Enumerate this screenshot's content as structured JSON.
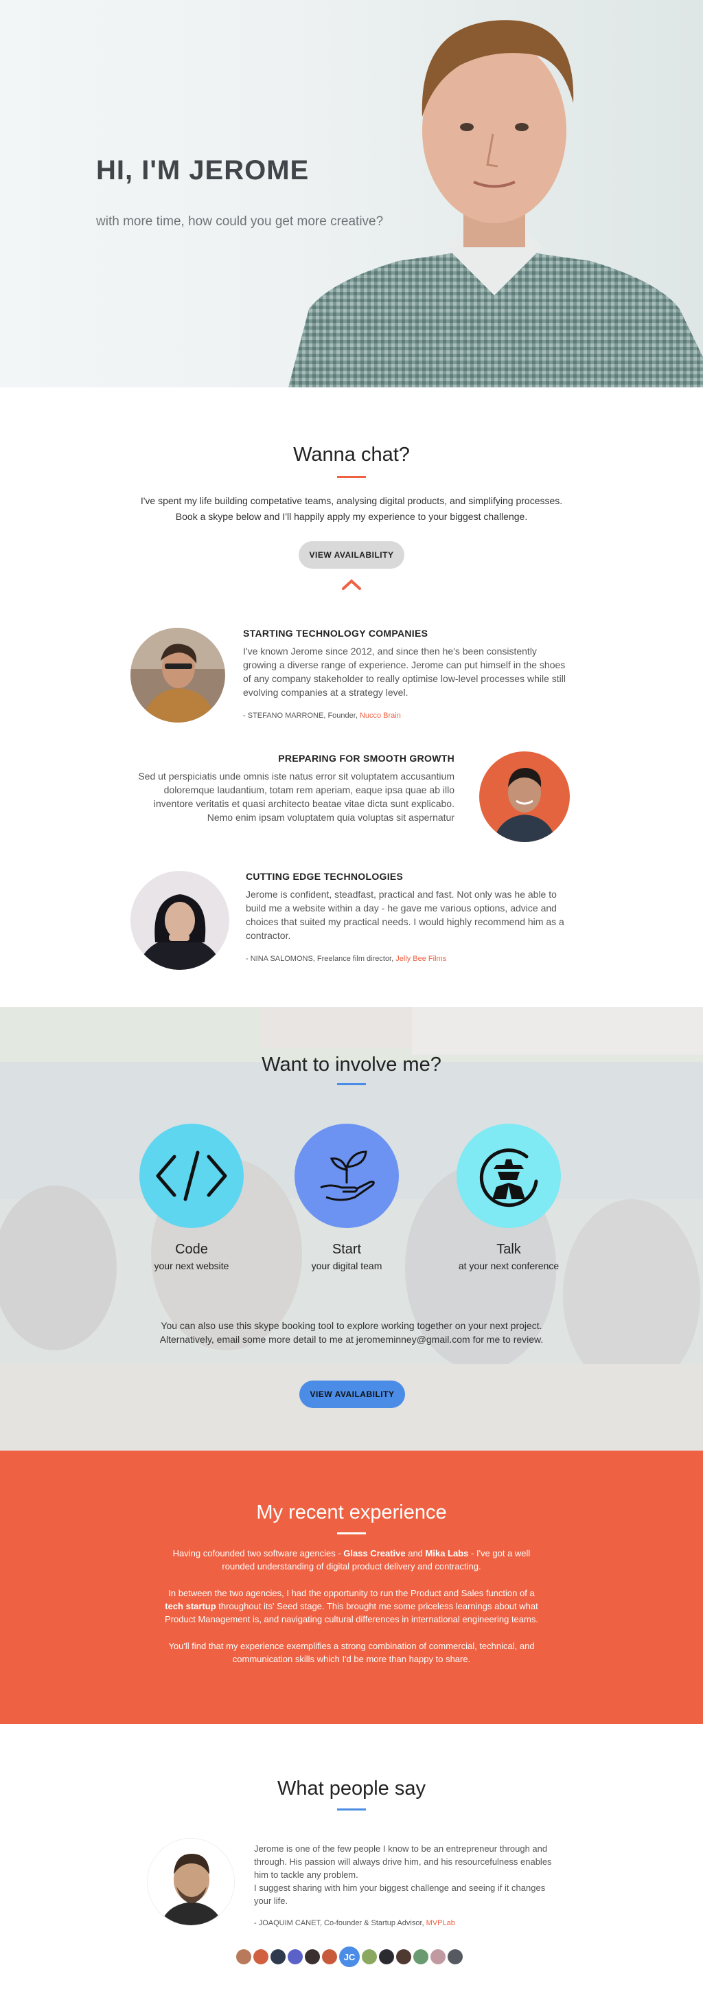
{
  "hero": {
    "title": "HI, I'M JEROME",
    "subtitle": "with more time, how could you get more creative?"
  },
  "chat": {
    "title": "Wanna chat?",
    "text": "I've spent my life building competative teams, analysing digital products, and simplifying processes. Book a skype below and I'll happily apply my experience to your biggest challenge.",
    "button": "VIEW AVAILABILITY",
    "chevron_icon": "chevron-up-icon"
  },
  "testimonials": [
    {
      "heading": "STARTING TECHNOLOGY COMPANIES",
      "body": "I've known Jerome since 2012, and since then he's been consistently growing a diverse range of experience. Jerome can put himself in the shoes of any company stakeholder to really optimise low-level processes while still evolving companies at a strategy level.",
      "cite_prefix": "- STEFANO MARRONE, Founder, ",
      "cite_link": "Nucco Brain"
    },
    {
      "heading": "PREPARING FOR SMOOTH GROWTH",
      "body": "Sed ut perspiciatis unde omnis iste natus error sit voluptatem accusantium doloremque laudantium, totam rem aperiam, eaque ipsa quae ab illo inventore veritatis et quasi architecto beatae vitae dicta sunt explicabo. Nemo enim ipsam voluptatem quia voluptas sit aspernatur"
    },
    {
      "heading": "CUTTING EDGE TECHNOLOGIES",
      "body": "Jerome is confident, steadfast, practical and fast. Not only was he able to build me a website within a day - he gave me various options, advice and choices that suited my practical needs. I would highly recommend him as a contractor.",
      "cite_prefix": "- NINA SALOMONS, Freelance film director, ",
      "cite_link": "Jelly Bee Films"
    }
  ],
  "involve": {
    "title": "Want to involve me?",
    "services": [
      {
        "name": "Code",
        "sub": "your next website",
        "icon": "code-icon"
      },
      {
        "name": "Start",
        "sub": "your digital team",
        "icon": "plant-in-hand-icon"
      },
      {
        "name": "Talk",
        "sub": "at your next conference",
        "icon": "speaker-icon"
      }
    ],
    "text": "You can also use this skype booking tool to explore working together on your next project. Alternatively, email some more detail to me at jeromeminney@gmail.com for me to review.",
    "button": "VIEW AVAILABILITY"
  },
  "experience": {
    "title": "My recent experience",
    "p1_a": "Having cofounded two software agencies - ",
    "p1_b": "Glass Creative",
    "p1_c": " and ",
    "p1_d": "Mika Labs",
    "p1_e": " - I've got a well rounded understanding of digital product delivery and contracting.",
    "p2_a": "In between the two agencies, I had the opportunity to run the Product and Sales function of a ",
    "p2_b": "tech startup",
    "p2_c": " throughout its' Seed stage. This brought me some priceless learnings about what Product Management is, and navigating cultural differences in international engineering teams.",
    "p3": "You'll find that my experience exemplifies a strong combination of commercial, technical, and communication skills which I'd be more than happy to share."
  },
  "people": {
    "title": "What people say",
    "quote_1": "Jerome is one of the few people I know to be an entrepreneur through and through. His passion will always drive him, and his resourcefulness enables him to tackle any problem.",
    "quote_2": "I suggest sharing with him your biggest challenge and seeing if it changes your life.",
    "cite_prefix": "- JOAQUIM CANET, Co-founder & Startup Advisor, ",
    "cite_link": "MVPLab",
    "active_avatar": "JC"
  },
  "colors": {
    "accent_orange": "#ee6142",
    "accent_blue": "#4a8ce6",
    "grey_button": "#d9d9d9",
    "code_circle": "#5fd6f0",
    "start_circle": "#6c93f1",
    "talk_circle": "#7fe9f4"
  }
}
